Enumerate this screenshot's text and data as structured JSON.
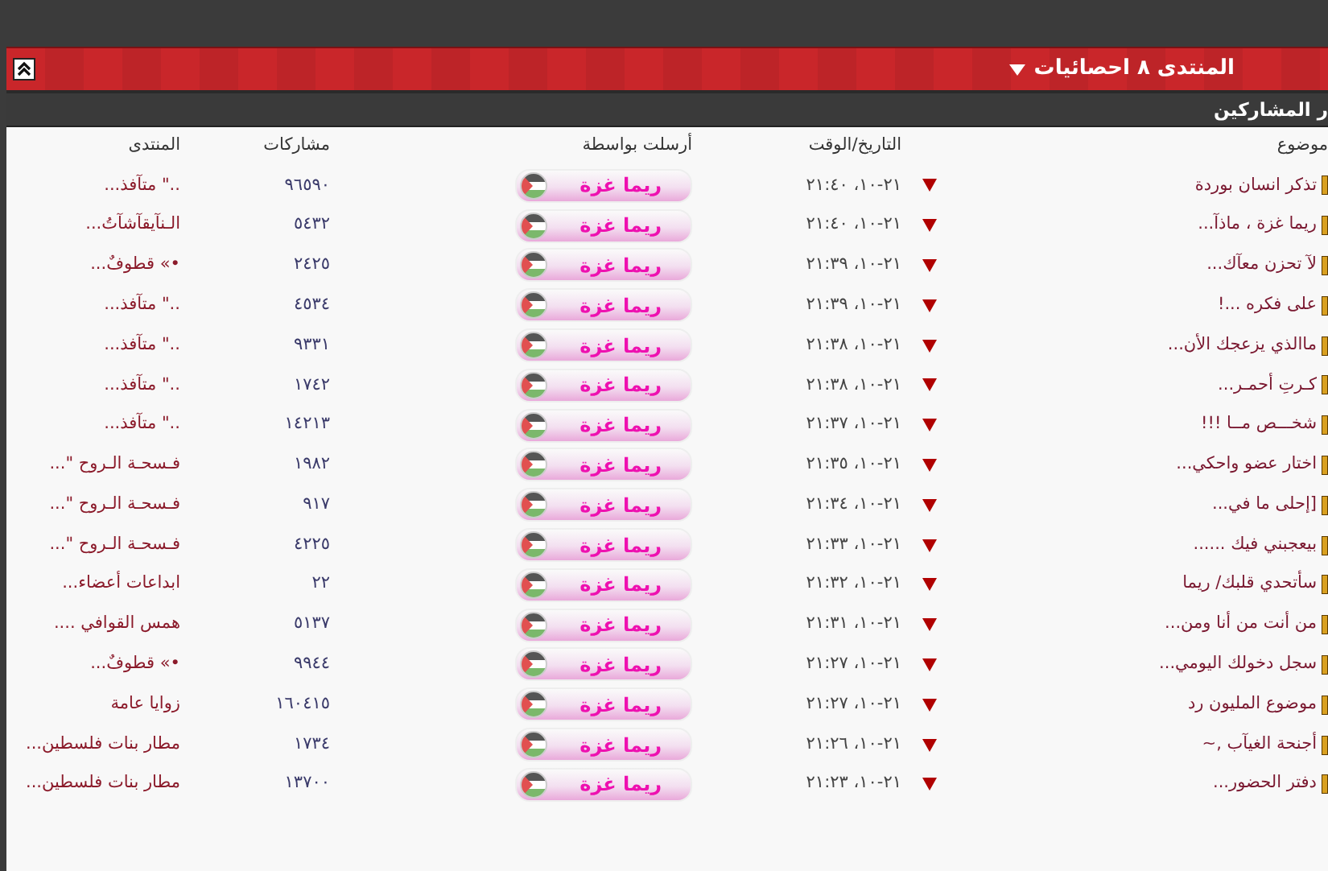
{
  "panel": {
    "title": "المنتدى ٨ احصائيات",
    "subtitle": "ر المشاركين"
  },
  "table": {
    "columns": [
      "موضوع",
      "التاريخ/الوقت",
      "أرسلت بواسطة",
      "مشاركات",
      "المنتدى"
    ],
    "rows": [
      {
        "topic": "تذكر انسان بوردة",
        "date": "٢١-١٠، ٢١:٤٠",
        "sender": "ريما غزة",
        "posts": "٩٦٥٩٠",
        "forum": "..\" متآفذ..."
      },
      {
        "topic": "ريما غزة ، ماذآ...",
        "date": "٢١-١٠، ٢١:٤٠",
        "sender": "ريما غزة",
        "posts": "٥٤٣٢",
        "forum": "الـنآيقآشآتُ..."
      },
      {
        "topic": "لآ تحزن معآك...",
        "date": "٢١-١٠، ٢١:٣٩",
        "sender": "ريما غزة",
        "posts": "٢٤٢٥",
        "forum": "•» قطوفٌ..."
      },
      {
        "topic": "على فكره ...!",
        "date": "٢١-١٠، ٢١:٣٩",
        "sender": "ريما غزة",
        "posts": "٤٥٣٤",
        "forum": "..\" متآفذ..."
      },
      {
        "topic": "ماالذي يزعجك الأن...",
        "date": "٢١-١٠، ٢١:٣٨",
        "sender": "ريما غزة",
        "posts": "٩٣٣١",
        "forum": "..\" متآفذ..."
      },
      {
        "topic": "كـرتِ أحمـر...",
        "date": "٢١-١٠، ٢١:٣٨",
        "sender": "ريما غزة",
        "posts": "١٧٤٢",
        "forum": "..\" متآفذ..."
      },
      {
        "topic": "شخـــص مــا !!!",
        "date": "٢١-١٠، ٢١:٣٧",
        "sender": "ريما غزة",
        "posts": "١٤٢١٣",
        "forum": "..\" متآفذ..."
      },
      {
        "topic": "اختار عضو واحكي...",
        "date": "٢١-١٠، ٢١:٣٥",
        "sender": "ريما غزة",
        "posts": "١٩٨٢",
        "forum": "فـسحـة الـروح \"..."
      },
      {
        "topic": "[إحلى ما في...",
        "date": "٢١-١٠، ٢١:٣٤",
        "sender": "ريما غزة",
        "posts": "٩١٧",
        "forum": "فـسحـة الـروح \"..."
      },
      {
        "topic": "بيعجبني فيك ......",
        "date": "٢١-١٠، ٢١:٣٣",
        "sender": "ريما غزة",
        "posts": "٤٢٢٥",
        "forum": "فـسحـة الـروح \"..."
      },
      {
        "topic": "سأتحدي قلبك/ ريما",
        "date": "٢١-١٠، ٢١:٣٢",
        "sender": "ريما غزة",
        "posts": "٢٢",
        "forum": "ابداعات أعضاء..."
      },
      {
        "topic": "من أنت من أنا ومن...",
        "date": "٢١-١٠، ٢١:٣١",
        "sender": "ريما غزة",
        "posts": "٥١٣٧",
        "forum": "همس القوافي ...."
      },
      {
        "topic": "سجل دخولك اليومي...",
        "date": "٢١-١٠، ٢١:٢٧",
        "sender": "ريما غزة",
        "posts": "٩٩٤٤",
        "forum": "•» قطوفٌ..."
      },
      {
        "topic": "موضوع المليون رد",
        "date": "٢١-١٠، ٢١:٢٧",
        "sender": "ريما غزة",
        "posts": "١٦٠٤١٥",
        "forum": "زوايا عامة"
      },
      {
        "topic": "أجنحة الغيآب ,~",
        "date": "٢١-١٠، ٢١:٢٦",
        "sender": "ريما غزة",
        "posts": "١٧٣٤",
        "forum": "مطار بنات فلسطين..."
      },
      {
        "topic": "دفتر الحضور...",
        "date": "٢١-١٠، ٢١:٢٣",
        "sender": "ريما غزة",
        "posts": "١٣٧٠٠",
        "forum": "مطار بنات فلسطين..."
      }
    ]
  }
}
